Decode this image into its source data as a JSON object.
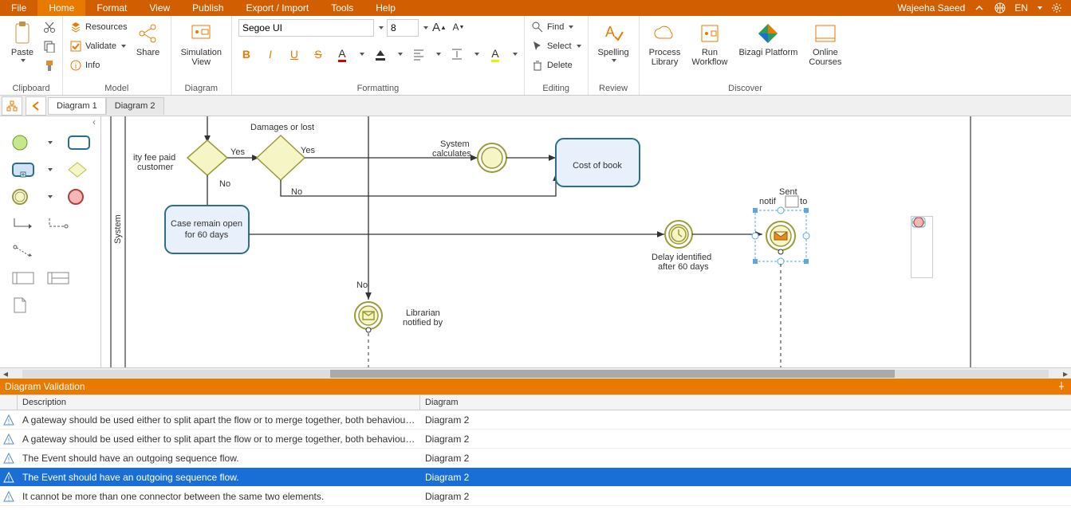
{
  "user": "Wajeeha Saeed",
  "lang": "EN",
  "menu": {
    "file": "File",
    "home": "Home",
    "format": "Format",
    "view": "View",
    "publish": "Publish",
    "export": "Export / Import",
    "tools": "Tools",
    "help": "Help"
  },
  "ribbon": {
    "clipboard": {
      "paste": "Paste",
      "label": "Clipboard"
    },
    "model": {
      "resources": "Resources",
      "validate": "Validate",
      "info": "Info",
      "share": "Share",
      "label": "Model"
    },
    "diagram": {
      "simview": "Simulation\nView",
      "label": "Diagram"
    },
    "formatting": {
      "font": "Segoe UI",
      "size": "8",
      "label": "Formatting"
    },
    "editing": {
      "find": "Find",
      "select": "Select",
      "delete": "Delete",
      "label": "Editing"
    },
    "review": {
      "spelling": "Spelling",
      "label": "Review"
    },
    "discover": {
      "plib": "Process\nLibrary",
      "runwf": "Run\nWorkflow",
      "platform": "Bizagi Platform",
      "courses": "Online\nCourses",
      "label": "Discover"
    }
  },
  "tabs": {
    "d1": "Diagram 1",
    "d2": "Diagram 2"
  },
  "lane": "System",
  "shapes": {
    "fee": "ity fee paid customer",
    "damages": "Damages or lost",
    "yes": "Yes",
    "no": "No",
    "syscalc": "System calculates",
    "cost": "Cost of book",
    "caseopen": "Case remain open for 60 days",
    "lib": "Librarian notified by",
    "delay": "Delay identified after 60 days",
    "sent": "Sent notification to"
  },
  "validation": {
    "title": "Diagram Validation",
    "col_desc": "Description",
    "col_diag": "Diagram",
    "rows": [
      {
        "desc": "A gateway should be used either to split apart the flow or to merge together, both behaviours in...",
        "diag": "Diagram 2",
        "sel": false
      },
      {
        "desc": "A gateway should be used either to split apart the flow or to merge together, both behaviours in...",
        "diag": "Diagram 2",
        "sel": false
      },
      {
        "desc": "The Event should have an outgoing sequence flow.",
        "diag": "Diagram 2",
        "sel": false
      },
      {
        "desc": "The Event should have an outgoing sequence flow.",
        "diag": "Diagram 2",
        "sel": true
      },
      {
        "desc": "It cannot be more than one connector between the same two elements.",
        "diag": "Diagram 2",
        "sel": false
      }
    ]
  }
}
